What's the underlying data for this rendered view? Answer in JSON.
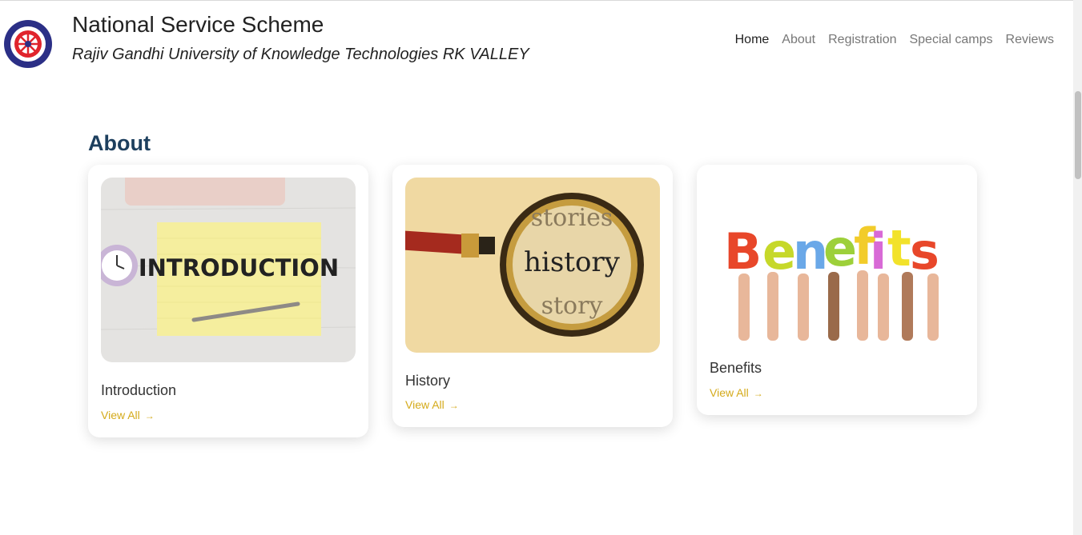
{
  "header": {
    "title": "National Service Scheme",
    "subtitle": "Rajiv Gandhi University of Knowledge Technologies RK VALLEY",
    "logo_icon": "nss-wheel-logo-icon"
  },
  "nav": {
    "items": [
      {
        "label": "Home",
        "active": true
      },
      {
        "label": "About",
        "active": false
      },
      {
        "label": "Registration",
        "active": false
      },
      {
        "label": "Special camps",
        "active": false
      },
      {
        "label": "Reviews",
        "active": false
      }
    ]
  },
  "about": {
    "heading": "About",
    "cards": [
      {
        "title": "Introduction",
        "image_text": "INTRODUCTION",
        "link": "View All"
      },
      {
        "title": "History",
        "image_text": "history",
        "link": "View All"
      },
      {
        "title": "Benefits",
        "image_text": "Benefits",
        "link": "View All"
      }
    ]
  },
  "colors": {
    "accent": "#d4aa1a",
    "heading": "#1d3f5e",
    "nav_active": "#222222",
    "nav_inactive": "#777777"
  }
}
